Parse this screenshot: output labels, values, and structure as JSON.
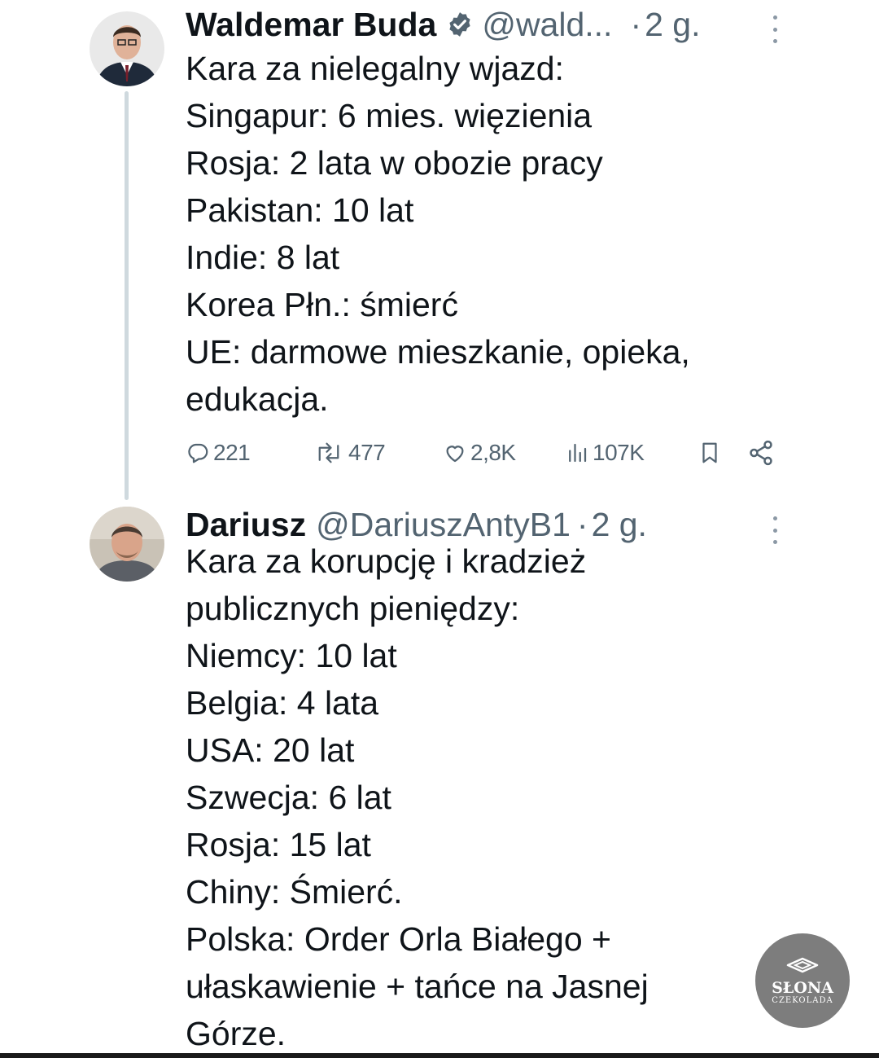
{
  "tweets": [
    {
      "author_name": "Waldemar Buda",
      "handle": "@wald...",
      "separator": "·",
      "time": "2 g.",
      "verified_icon": "verified-badge-icon",
      "lines": [
        "Kara za nielegalny wjazd:",
        "Singapur: 6 mies. więzienia",
        "Rosja: 2 lata w obozie pracy",
        "Pakistan: 10 lat",
        "Indie: 8 lat",
        "Korea Płn.: śmierć",
        "UE: darmowe mieszkanie, opieka,",
        "edukacja."
      ],
      "stats": {
        "replies": "221",
        "retweets": "477",
        "likes": "2,8K",
        "views": "107K"
      }
    },
    {
      "author_name": "Dariusz",
      "handle": "@DariuszAntyB1",
      "separator": "·",
      "time": "2 g.",
      "lines": [
        "Kara za korupcję i kradzież",
        "publicznych pieniędzy:",
        "Niemcy: 10 lat",
        "Belgia: 4 lata",
        "USA: 20 lat",
        "Szwecja: 6 lat",
        "Rosja: 15 lat",
        "Chiny: Śmierć.",
        "Polska: Order Orla Białego +",
        "ułaskawienie + tańce na Jasnej",
        "Górze."
      ]
    }
  ],
  "watermark": {
    "line1": "SŁONA",
    "line2": "CZEKOLADA"
  },
  "colors": {
    "text": "#0f1419",
    "secondary": "#536471",
    "thread_line": "#cfd9de"
  }
}
